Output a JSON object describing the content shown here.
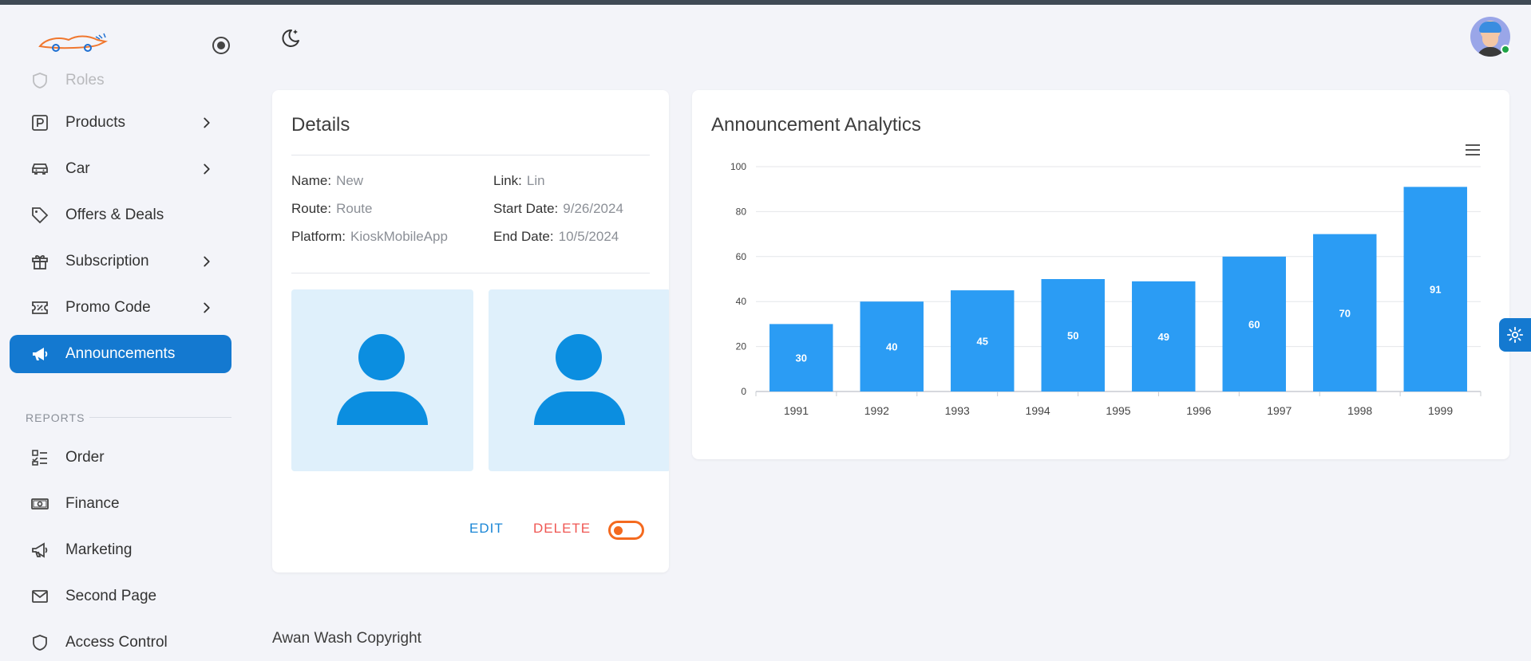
{
  "sidebar": {
    "items_top": [
      {
        "label": "Roles",
        "icon": "shield-icon"
      },
      {
        "label": "Products",
        "icon": "product-box-icon",
        "has_submenu": true
      },
      {
        "label": "Car",
        "icon": "car-icon",
        "has_submenu": true
      },
      {
        "label": "Offers & Deals",
        "icon": "tag-icon",
        "has_submenu": false
      },
      {
        "label": "Subscription",
        "icon": "gift-icon",
        "has_submenu": true
      },
      {
        "label": "Promo Code",
        "icon": "promo-ticket-icon",
        "has_submenu": true
      },
      {
        "label": "Announcements",
        "icon": "megaphone-icon",
        "has_submenu": false,
        "active": true
      }
    ],
    "section_label": "REPORTS",
    "items_reports": [
      {
        "label": "Order",
        "icon": "checklist-icon"
      },
      {
        "label": "Finance",
        "icon": "money-icon"
      },
      {
        "label": "Marketing",
        "icon": "megaphone-outline-icon"
      },
      {
        "label": "Second Page",
        "icon": "mail-icon"
      },
      {
        "label": "Access Control",
        "icon": "shield-icon"
      }
    ]
  },
  "details": {
    "title": "Details",
    "fields": [
      {
        "label": "Name:",
        "value": "New"
      },
      {
        "label": "Link:",
        "value": "Lin"
      },
      {
        "label": "Route:",
        "value": "Route"
      },
      {
        "label": "Start Date:",
        "value": "9/26/2024"
      },
      {
        "label": "Platform:",
        "value": "KioskMobileApp"
      },
      {
        "label": "End Date:",
        "value": "10/5/2024"
      }
    ],
    "edit_label": "EDIT",
    "delete_label": "DELETE",
    "toggle_on": false
  },
  "analytics": {
    "title": "Announcement Analytics"
  },
  "chart_data": {
    "type": "bar",
    "categories": [
      "1991",
      "1992",
      "1993",
      "1994",
      "1995",
      "1996",
      "1997",
      "1998",
      "1999"
    ],
    "values": [
      30,
      40,
      45,
      50,
      49,
      60,
      70,
      91
    ],
    "ylim": [
      0,
      100
    ],
    "yticks": [
      0,
      20,
      40,
      60,
      80,
      100
    ],
    "bar_color": "#2b9cf4",
    "grid": true,
    "data_labels": true
  },
  "footer": {
    "text": "Awan Wash Copyright"
  },
  "colors": {
    "accent": "#1479d0",
    "delete": "#ef5753",
    "toggle": "#f46a1f"
  }
}
